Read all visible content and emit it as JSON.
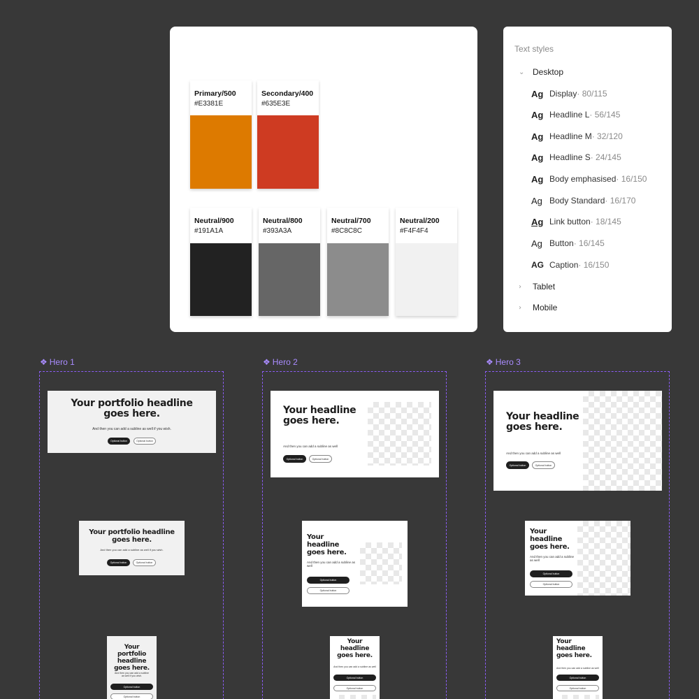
{
  "palette": {
    "primary_colors": [
      {
        "name": "Primary/500",
        "hex": "#E3381E",
        "swatch": "#DD7A00"
      },
      {
        "name": "Secondary/400",
        "hex": "#635E3E",
        "swatch": "#CE3B22"
      }
    ],
    "neutral_colors": [
      {
        "name": "Neutral/900",
        "hex": "#191A1A",
        "swatch": "#222222"
      },
      {
        "name": "Neutral/800",
        "hex": "#393A3A",
        "swatch": "#666666"
      },
      {
        "name": "Neutral/700",
        "hex": "#8C8C8C",
        "swatch": "#8C8C8C"
      },
      {
        "name": "Neutral/200",
        "hex": "#F4F4F4",
        "swatch": "#F1F1F1"
      }
    ]
  },
  "text_styles": {
    "section_title": "Text styles",
    "desktop": {
      "label": "Desktop",
      "expanded_icon": "chevron-down-icon",
      "items": [
        {
          "ag": "Ag",
          "name": "Display",
          "meta": " · 80/115"
        },
        {
          "ag": "Ag",
          "name": "Headline L",
          "meta": " · 56/145"
        },
        {
          "ag": "Ag",
          "name": "Headline M",
          "meta": " · 32/120"
        },
        {
          "ag": "Ag",
          "name": "Headline S",
          "meta": " · 24/145"
        },
        {
          "ag": "Ag",
          "name": "Body emphasised",
          "meta": " · 16/150"
        },
        {
          "ag": "Ag",
          "name": "Body Standard",
          "meta": " · 16/170"
        },
        {
          "ag": "Ag",
          "name": "Link button",
          "meta": " · 18/145"
        },
        {
          "ag": "Ag",
          "name": "Button",
          "meta": " · 16/145"
        },
        {
          "ag": "AG",
          "name": "Caption",
          "meta": " · 16/150"
        }
      ]
    },
    "tablet": {
      "label": "Tablet",
      "collapsed_icon": "chevron-right-icon"
    },
    "mobile": {
      "label": "Mobile",
      "collapsed_icon": "chevron-right-icon"
    }
  },
  "heroes": [
    {
      "label": "Hero 1",
      "icon": "component-icon"
    },
    {
      "label": "Hero 2",
      "icon": "component-icon"
    },
    {
      "label": "Hero 3",
      "icon": "component-icon"
    }
  ],
  "content": {
    "portfolio_headline": "Your portfolio headline goes here.",
    "portfolio_subline": "And then you can add a subline as well if you wish.",
    "headline": "Your headline goes here.",
    "subline": "And then you can add a subline as well",
    "button_label": "Optional button"
  },
  "colors": {
    "canvas": "#383838",
    "frame_border": "#8B5CF6",
    "frame_label": "#A98BFF"
  }
}
